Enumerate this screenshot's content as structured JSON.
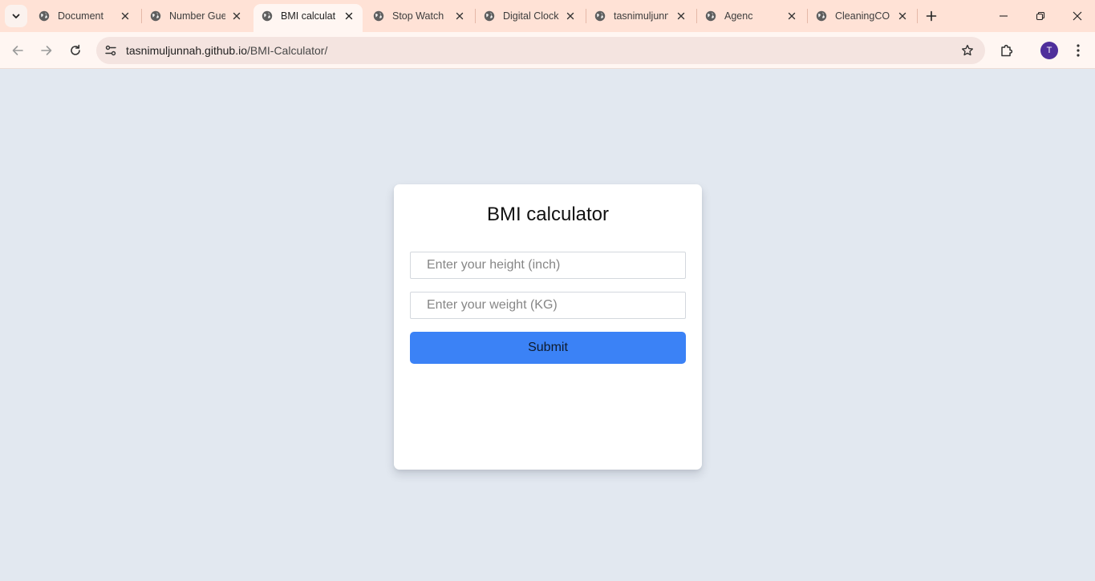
{
  "browser": {
    "tabs": [
      {
        "title": "Document",
        "active": false
      },
      {
        "title": "Number Gue",
        "active": false
      },
      {
        "title": "BMI calculato",
        "active": true
      },
      {
        "title": "Stop Watch",
        "active": false
      },
      {
        "title": "Digital Clock",
        "active": false
      },
      {
        "title": "tasnimuljunn",
        "active": false
      },
      {
        "title": "Agenc",
        "active": false
      },
      {
        "title": "CleaningCO",
        "active": false
      }
    ],
    "address_bar": {
      "host": "tasnimuljunnah.github.io",
      "path": "/BMI-Calculator/"
    },
    "profile_initial": "T",
    "accent_color": "#ffe2d6"
  },
  "page": {
    "background_color": "#e2e8f0",
    "card": {
      "title": "BMI calculator",
      "height_input": {
        "placeholder": "Enter your height (inch)",
        "value": ""
      },
      "weight_input": {
        "placeholder": "Enter your weight (KG)",
        "value": ""
      },
      "submit_label": "Submit",
      "submit_color": "#3b82f6"
    }
  }
}
